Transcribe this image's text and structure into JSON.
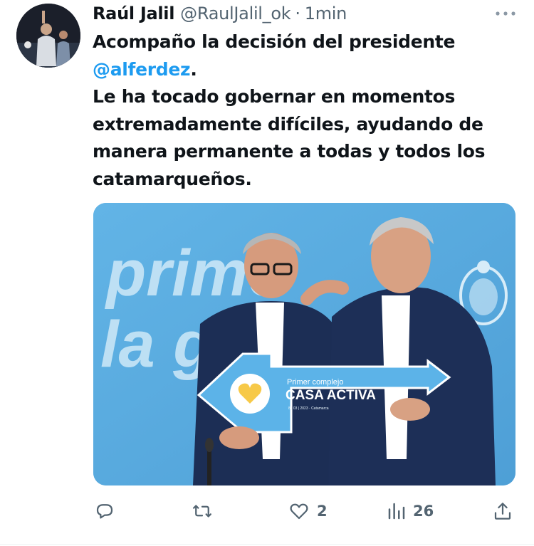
{
  "author": {
    "name": "Raúl Jalil",
    "handle": "@RaulJalil_ok",
    "separator": "·",
    "time": "1min"
  },
  "tweet": {
    "line1_prefix": "Acompaño la decisión del presidente",
    "mention": "@alferdez",
    "line1_suffix": ".",
    "body": "Le ha tocado gobernar en momentos extremadamente difíciles, ayudando de manera permanente a todas y todos los catamarqueños."
  },
  "media": {
    "backdrop_text_1": "prime",
    "backdrop_text_2": "la g",
    "sign_small": "Primer complejo",
    "sign_big": "CASA ACTIVA",
    "sign_date": "8 | 03 | 2023 · Catamarca"
  },
  "actions": {
    "reply_icon": "reply-icon",
    "retweet_icon": "retweet-icon",
    "like_icon": "heart-icon",
    "like_count": "2",
    "views_icon": "views-icon",
    "views_count": "26",
    "share_icon": "share-icon"
  },
  "colors": {
    "text": "#0f1419",
    "secondary": "#536471",
    "link": "#1d9bf0",
    "backdrop_blue": "#5aaee2"
  }
}
